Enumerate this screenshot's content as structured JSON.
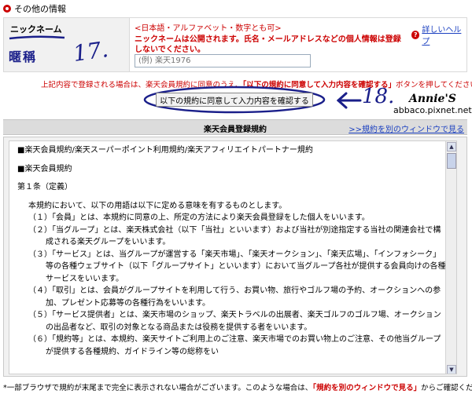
{
  "section": {
    "title": "その他の情報"
  },
  "nickname": {
    "label": "ニックネーム",
    "hand_label": "暱稱",
    "hand_number": "17.",
    "note1": "<日本語・アルファベット・数字とも可>",
    "note2": "ニックネームは公開されます。氏名・メールアドレスなどの個人情報は登録しないでください。",
    "placeholder": "(例) 楽天1976"
  },
  "help": {
    "label": "詳しいヘルプ"
  },
  "register_note": {
    "before": "上記内容で登録される場合は、楽天会員規約に同意のうえ、",
    "emph": "「以下の規約に同意して入力内容を確認する」",
    "after": "ボタンを押してください。"
  },
  "confirm_button": {
    "label": "以下の規約に同意して入力内容を確認する"
  },
  "annotation": {
    "number": "18.",
    "name": "Annie'S",
    "url": "abbaco.pixnet.net"
  },
  "terms": {
    "title": "楽天会員登録規約",
    "link": ">>規約を別のウィンドウで見る",
    "heading1": "■楽天会員規約/楽天スーパーポイント利用規約/楽天アフィリエイトパートナー規約",
    "heading2": "■楽天会員規約",
    "article": "第１条（定義）",
    "intro": "本規約において、以下の用語は以下に定める意味を有するものとします。",
    "items": [
      "（１）「会員」とは、本規約に同意の上、所定の方法により楽天会員登録をした個人をいいます。",
      "（２）「当グループ」とは、楽天株式会社（以下「当社」といいます）および当社が別途指定する当社の関連会社で構成される楽天グループをいいます。",
      "（３）「サービス」とは、当グループが運営する「楽天市場」、「楽天オークション」、「楽天広場」、「インフォシーク」等の各種ウェブサイト（以下「グループサイト」といいます）において当グループ各社が提供する会員向けの各種サービスをいいます。",
      "（４）「取引」とは、会員がグループサイトを利用して行う、お買い物、旅行やゴルフ場の予約、オークションへの参加、プレゼント応募等の各種行為をいいます。",
      "（５）「サービス提供者」とは、楽天市場のショップ、楽天トラベルの出展者、楽天ゴルフのゴルフ場、オークションの出品者など、取引の対象となる商品または役務を提供する者をいいます。",
      "（６）「規約等」とは、本規約、楽天サイトご利用上のご注意、楽天市場でのお買い物上のご注意、その他当グループが提供する各種規約、ガイドライン等の総称をい"
    ]
  },
  "footer": {
    "before": "*一部ブラウザで規約が末尾まで完全に表示されない場合がございます。このような場合は、",
    "red": "「規約を別のウィンドウで見る」",
    "after": "からご確認くだ"
  }
}
